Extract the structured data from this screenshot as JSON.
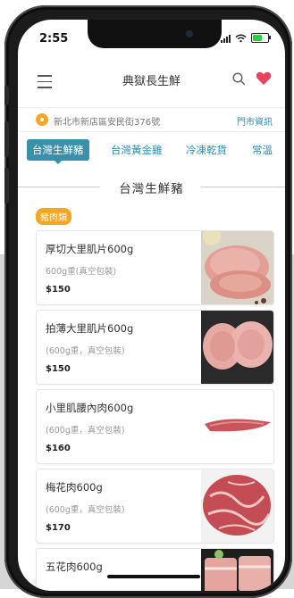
{
  "status": {
    "time": "2:55"
  },
  "header": {
    "title": "典獄長生鮮"
  },
  "location": {
    "address": "新北市新店區安民街376號",
    "store_info_label": "門市資訊"
  },
  "tabs": [
    {
      "label": "台灣生鮮豬",
      "active": true
    },
    {
      "label": "台灣黃金雞",
      "active": false
    },
    {
      "label": "冷凍乾貨",
      "active": false
    },
    {
      "label": "常溫",
      "active": false
    }
  ],
  "section": {
    "title": "台灣生鮮豬",
    "category_badge": "豬肉類"
  },
  "products": [
    {
      "name": "厚切大里肌片600g",
      "desc": "600g重(真空包裝)",
      "price": "$150",
      "image": "pork-loin-slices-photo"
    },
    {
      "name": "拍薄大里肌片600g",
      "desc": "(600g重，真空包裝)",
      "price": "$150",
      "image": "thin-pork-cutlet-photo"
    },
    {
      "name": "小里肌腰內肉600g",
      "desc": "(600g重，真空包裝)",
      "price": "$160",
      "image": "pork-tenderloin-photo"
    },
    {
      "name": "梅花肉600g",
      "desc": "(600g重，真空包裝)",
      "price": "$170",
      "image": "pork-shoulder-photo"
    },
    {
      "name": "五花肉600g",
      "desc": "",
      "price": "",
      "image": "pork-belly-photo"
    }
  ],
  "colors": {
    "accent": "#3a8faa",
    "badge": "#f5a623",
    "heart": "#e8435a",
    "link": "#2a8bb0"
  }
}
